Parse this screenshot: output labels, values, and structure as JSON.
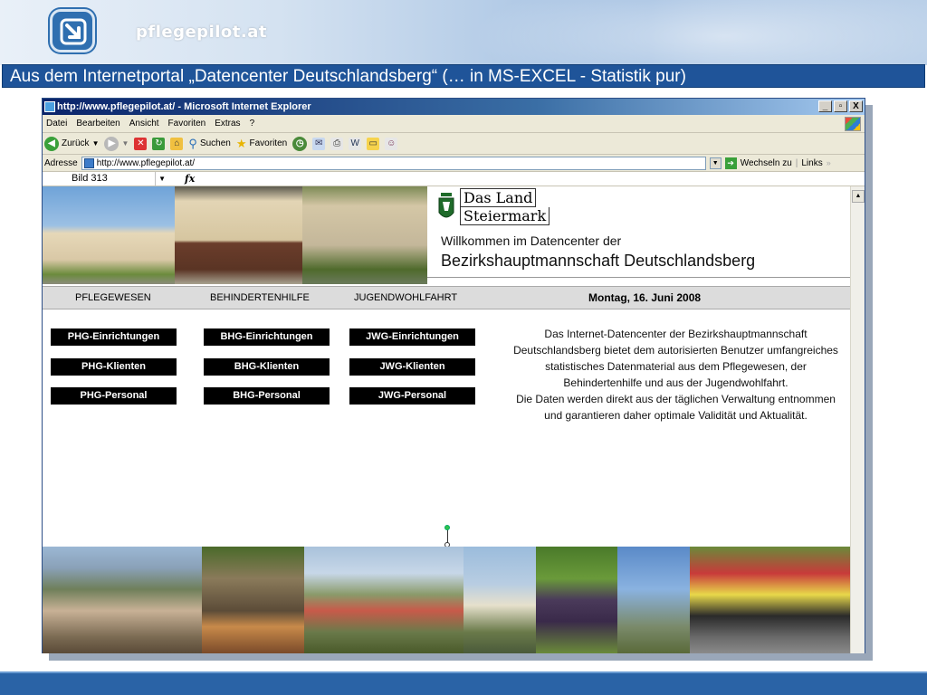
{
  "slide": {
    "brand": "pflegepilot.at",
    "title": "Aus dem Internetportal „Datencenter Deutschlandsberg“ (… in MS-EXCEL - Statistik pur)",
    "colors": {
      "title_bar": "#1f5499",
      "bottom_bar": "#2a63a6"
    }
  },
  "browser": {
    "window_title": "http://www.pflegepilot.at/ - Microsoft Internet Explorer",
    "window_buttons": [
      "_",
      "▫",
      "X"
    ],
    "menu": [
      "Datei",
      "Bearbeiten",
      "Ansicht",
      "Favoriten",
      "Extras",
      "?"
    ],
    "toolbar": {
      "back": "Zurück",
      "search": "Suchen",
      "favorites": "Favoriten"
    },
    "address": {
      "label": "Adresse",
      "value": "http://www.pflegepilot.at/",
      "go": "Wechseln zu",
      "links": "Links"
    },
    "formula": {
      "namebox": "Bild 313",
      "fx": "fx"
    }
  },
  "page": {
    "land_line1": "Das Land",
    "land_line2": "Steiermark",
    "welcome_line1": "Willkommen im Datencenter der",
    "welcome_line2": "Bezirkshauptmannschaft Deutschlandsberg",
    "nav": [
      "PFLEGEWESEN",
      "BEHINDERTENHILFE",
      "JUGENDWOHLFAHRT"
    ],
    "date": "Montag, 16. Juni 2008",
    "buttons": {
      "phg": [
        "PHG-Einrichtungen",
        "PHG-Klienten",
        "PHG-Personal"
      ],
      "bhg": [
        "BHG-Einrichtungen",
        "BHG-Klienten",
        "BHG-Personal"
      ],
      "jwg": [
        "JWG-Einrichtungen",
        "JWG-Klienten",
        "JWG-Personal"
      ]
    },
    "info_text": "Das Internet-Datencenter der Bezirkshauptmannschaft Deutschlandsberg bietet dem autorisierten Benutzer umfangreiches statistisches Datenmaterial aus dem Pflegewesen, der Behindertenhilfe und aus der Jugendwohlfahrt.",
    "info_text2": "Die Daten werden direkt aus der täglichen Verwaltung entnommen und garantieren daher optimale Validität und Aktualität."
  }
}
